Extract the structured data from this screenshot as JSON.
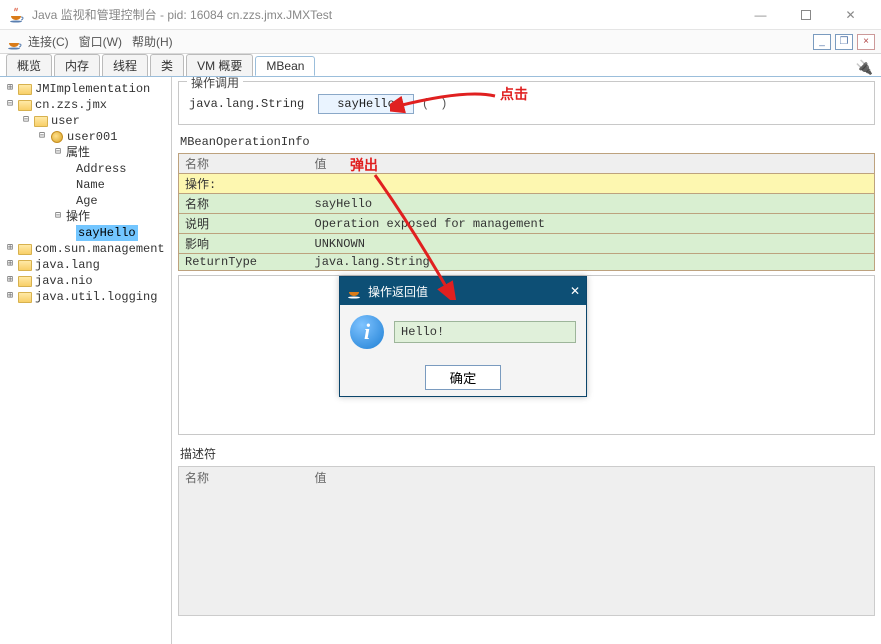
{
  "title": "Java 监视和管理控制台 - pid: 16084 cn.zzs.jmx.JMXTest",
  "menu": {
    "connect": "连接(C)",
    "window": "窗口(W)",
    "help": "帮助(H)"
  },
  "tabs": {
    "overview": "概览",
    "memory": "内存",
    "threads": "线程",
    "classes": "类",
    "vm": "VM 概要",
    "mbean": "MBean"
  },
  "tree": {
    "root1": "JMImplementation",
    "pkg": "cn.zzs.jmx",
    "user": "user",
    "user001": "user001",
    "attrs": "属性",
    "attr_address": "Address",
    "attr_name": "Name",
    "attr_age": "Age",
    "ops": "操作",
    "op_sayhello": "sayHello",
    "sun": "com.sun.management",
    "lang": "java.lang",
    "nio": "java.nio",
    "logging": "java.util.logging"
  },
  "operation": {
    "section_title": "操作调用",
    "return_type": "java.lang.String",
    "button": "sayHello",
    "parens": "( )"
  },
  "info": {
    "section_title": "MBeanOperationInfo",
    "col_name": "名称",
    "col_value": "值",
    "row_op_label": "操作:",
    "rows": {
      "name_k": "名称",
      "name_v": "sayHello",
      "desc_k": "说明",
      "desc_v": "Operation exposed for management",
      "impact_k": "影响",
      "impact_v": "UNKNOWN",
      "ret_k": "ReturnType",
      "ret_v": "java.lang.String"
    }
  },
  "desc": {
    "section_title": "描述符",
    "col_name": "名称",
    "col_value": "值"
  },
  "dialog": {
    "title": "操作返回值",
    "value": "Hello!",
    "ok": "确定"
  },
  "annotation": {
    "click": "点击",
    "popup": "弹出"
  }
}
